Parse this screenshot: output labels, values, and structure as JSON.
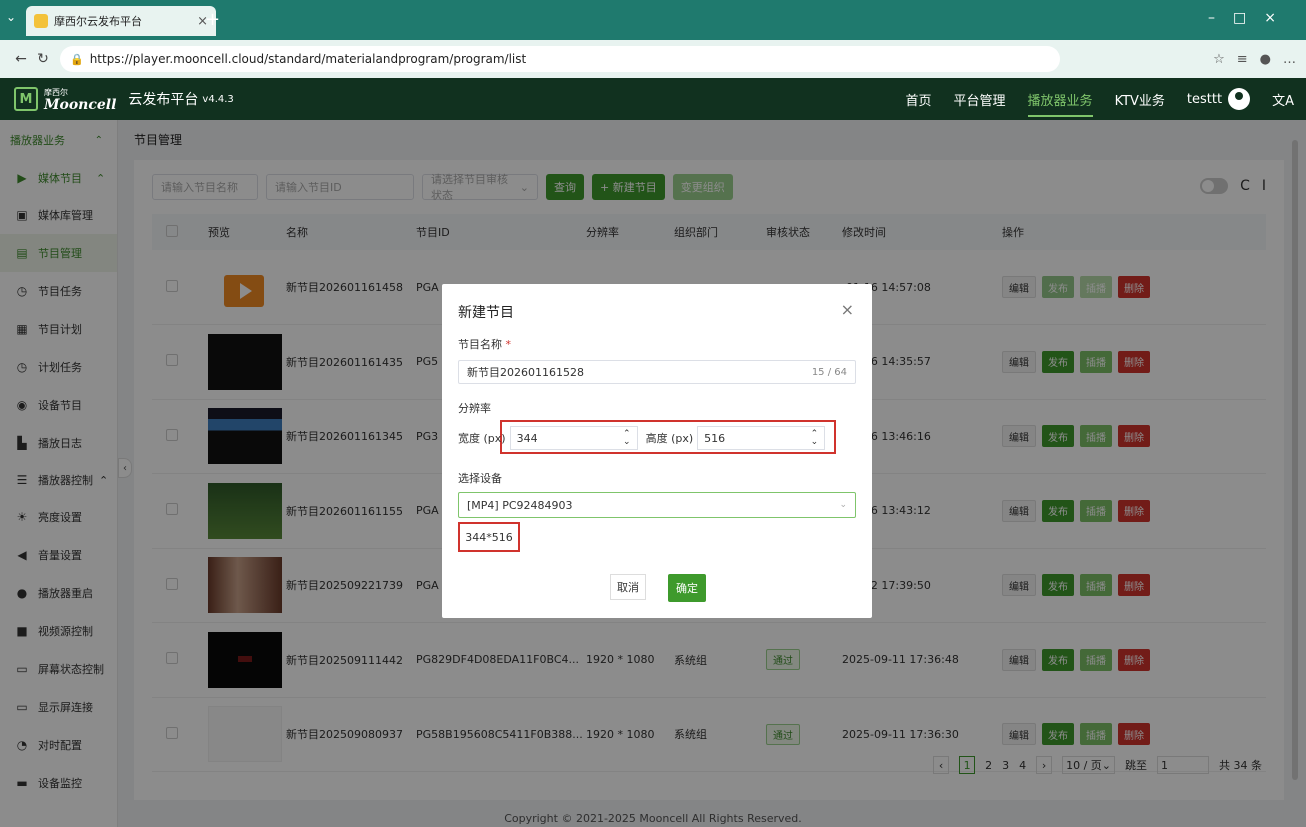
{
  "browser": {
    "tab_title": "摩西尔云发布平台",
    "url": "https://player.mooncell.cloud/standard/materialandprogram/program/list"
  },
  "header": {
    "logo_small": "摩西尔",
    "logo_name": "Mooncell",
    "title": "云发布平台",
    "version": "v4.4.3",
    "nav": [
      "首页",
      "平台管理",
      "播放器业务",
      "KTV业务"
    ],
    "user": "testtt",
    "lang_icon": "文A"
  },
  "sidebar": {
    "group": "播放器业务",
    "sub_media": "媒体节目",
    "media_items": [
      "媒体库管理",
      "节目管理",
      "节目任务",
      "节目计划",
      "计划任务",
      "设备节目",
      "播放日志"
    ],
    "sub_control": "播放器控制",
    "control_items": [
      "亮度设置",
      "音量设置",
      "播放器重启",
      "视频源控制",
      "屏幕状态控制",
      "显示屏连接",
      "对时配置",
      "设备监控"
    ]
  },
  "breadcrumb": "节目管理",
  "toolbar": {
    "name_placeholder": "请输入节目名称",
    "id_placeholder": "请输入节目ID",
    "status_placeholder": "请选择节目审核状态",
    "query": "查询",
    "new_program": "+ 新建节目",
    "change_org": "变更组织"
  },
  "table": {
    "headers": [
      "预览",
      "名称",
      "节目ID",
      "分辨率",
      "组织部门",
      "审核状态",
      "修改时间",
      "操作"
    ],
    "rows": [
      {
        "name": "新节目202601161458",
        "id": "PGA",
        "res": "",
        "org": "",
        "status": "",
        "time": "-01-16 14:57:08"
      },
      {
        "name": "新节目202601161435",
        "id": "PG5",
        "res": "",
        "org": "",
        "status": "",
        "time": "-01-16 14:35:57"
      },
      {
        "name": "新节目202601161345",
        "id": "PG3",
        "res": "",
        "org": "",
        "status": "",
        "time": "-01-16 13:46:16"
      },
      {
        "name": "新节目202601161155",
        "id": "PGA",
        "res": "",
        "org": "",
        "status": "",
        "time": "-01-16 13:43:12"
      },
      {
        "name": "新节目202509221739",
        "id": "PGA",
        "res": "",
        "org": "",
        "status": "",
        "time": "-09-22 17:39:50"
      },
      {
        "name": "新节目202509111442",
        "id": "PG829DF4D08EDA11F0BC4...",
        "res": "1920 * 1080",
        "org": "系统组",
        "status": "通过",
        "time": "2025-09-11 17:36:48"
      },
      {
        "name": "新节目202509080937",
        "id": "PG58B195608C5411F0B388...",
        "res": "1920 * 1080",
        "org": "系统组",
        "status": "通过",
        "time": "2025-09-11 17:36:30"
      }
    ],
    "ops": {
      "edit": "编辑",
      "publish": "发布",
      "insert": "插播",
      "delete": "删除"
    }
  },
  "pagination": {
    "pages": [
      "1",
      "2",
      "3",
      "4"
    ],
    "page_size": "10 / 页",
    "jump_label": "跳至",
    "jump_value": "1",
    "total": "共 34 条"
  },
  "footer": "Copyright © 2021-2025 Mooncell All Rights Reserved.",
  "modal": {
    "title": "新建节目",
    "name_label": "节目名称",
    "name_value": "新节目202601161528",
    "name_count": "15 / 64",
    "res_label": "分辨率",
    "width_label": "宽度 (px)",
    "width_value": "344",
    "height_label": "高度 (px)",
    "height_value": "516",
    "device_label": "选择设备",
    "device_value": "[MP4] PC92484903",
    "size_text": "344*516",
    "cancel": "取消",
    "ok": "确定"
  }
}
